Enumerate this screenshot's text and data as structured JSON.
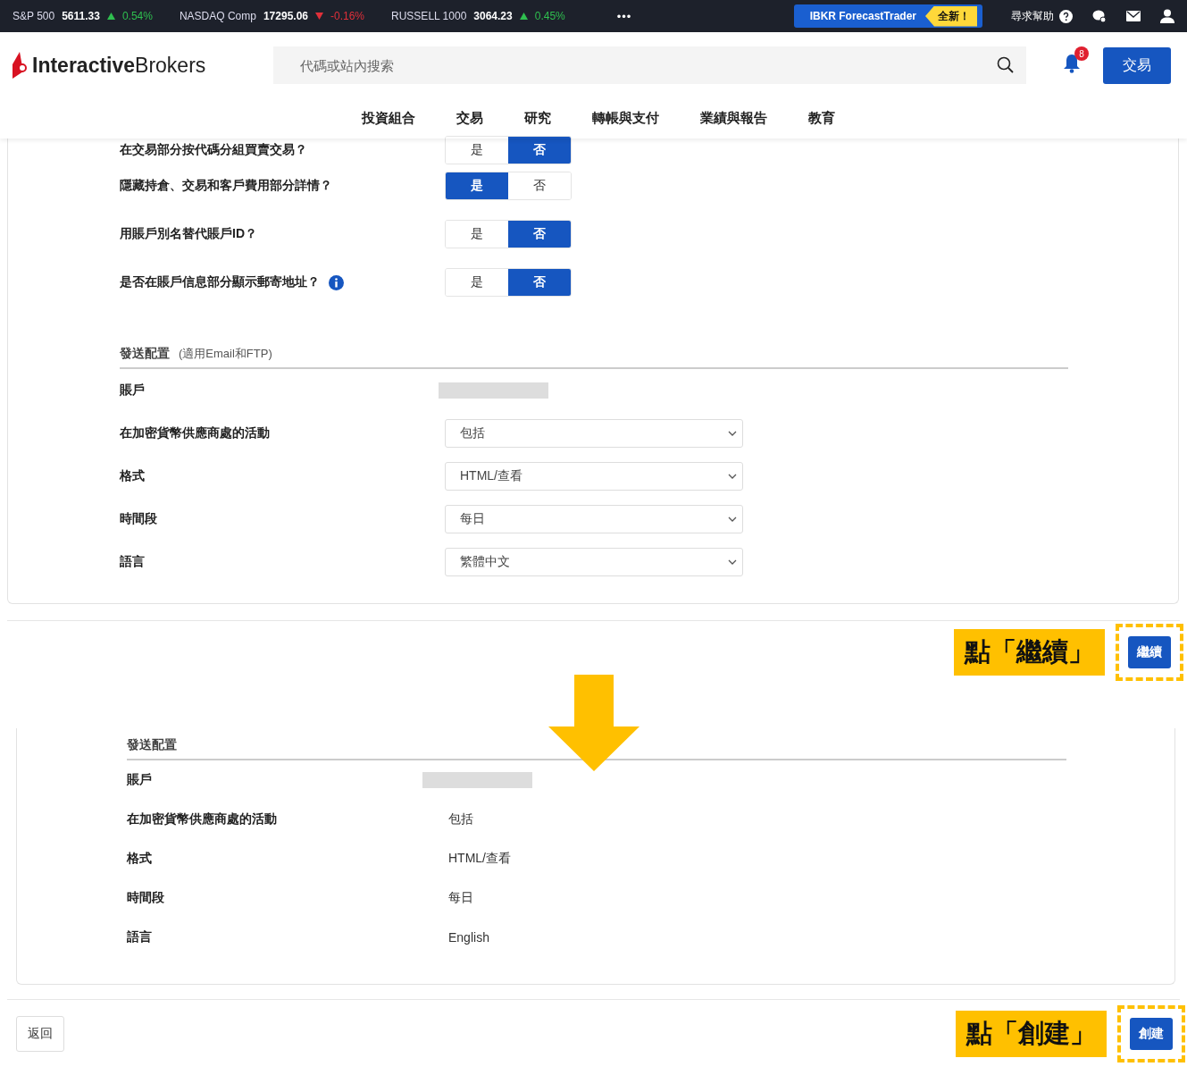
{
  "ticker": [
    {
      "name": "S&P 500",
      "value": "5611.33",
      "change": "0.54%",
      "rising": true
    },
    {
      "name": "NASDAQ Comp",
      "value": "17295.06",
      "change": "-0.16%",
      "rising": false
    },
    {
      "name": "RUSSELL 1000",
      "value": "3064.23",
      "change": "0.45%",
      "rising": true
    }
  ],
  "top_bar": {
    "more": "•••",
    "promo": {
      "label": "IBKR ForecastTrader",
      "badge": "全新！"
    },
    "help": "尋求幫助"
  },
  "header": {
    "logo": "**Interactive**Brokers",
    "search": {
      "placeholder": "代碼或站內搜索"
    },
    "notifications": "8",
    "trade_button": "交易"
  },
  "nav": [
    "投資組合",
    "交易",
    "研究",
    "轉帳與支付",
    "業績與報告",
    "教育"
  ],
  "questions": [
    {
      "label": "在交易部分按代碼分組買賣交易？",
      "info": false,
      "options": [
        {
          "label": "是",
          "selected": false
        },
        {
          "label": "否",
          "selected": true
        }
      ]
    },
    {
      "label": "隱藏持倉、交易和客戶費用部分詳情？",
      "info": false,
      "options": [
        {
          "label": "是",
          "selected": true
        },
        {
          "label": "否",
          "selected": false
        }
      ]
    },
    {
      "label": "用賬戶別名替代賬戶ID？",
      "info": false,
      "options": [
        {
          "label": "是",
          "selected": false
        },
        {
          "label": "否",
          "selected": true
        }
      ]
    },
    {
      "label": "是否在賬戶信息部分顯示郵寄地址？",
      "info": true,
      "options": [
        {
          "label": "是",
          "selected": false
        },
        {
          "label": "否",
          "selected": true
        }
      ]
    }
  ],
  "delivery": {
    "title": "發送配置",
    "note": "(適用Email和FTP)",
    "fields": [
      {
        "label": "賬戶",
        "kind": "masked"
      },
      {
        "label": "在加密貨幣供應商處的活動",
        "kind": "select",
        "value": "包括"
      },
      {
        "label": "格式",
        "kind": "select",
        "value": "HTML/查看"
      },
      {
        "label": "時間段",
        "kind": "select",
        "value": "每日"
      },
      {
        "label": "語言",
        "kind": "select",
        "value": "繁體中文"
      }
    ]
  },
  "continue_step": {
    "callout": "點「繼續」",
    "button": "繼續"
  },
  "review": {
    "title": "發送配置",
    "fields": [
      {
        "label": "賬戶",
        "kind": "masked"
      },
      {
        "label": "在加密貨幣供應商處的活動",
        "kind": "text",
        "value": "包括"
      },
      {
        "label": "格式",
        "kind": "text",
        "value": "HTML/查看"
      },
      {
        "label": "時間段",
        "kind": "text",
        "value": "每日"
      },
      {
        "label": "語言",
        "kind": "text",
        "value": "English"
      }
    ]
  },
  "footer": {
    "back": "返回",
    "callout": "點「創建」",
    "button": "創建"
  }
}
